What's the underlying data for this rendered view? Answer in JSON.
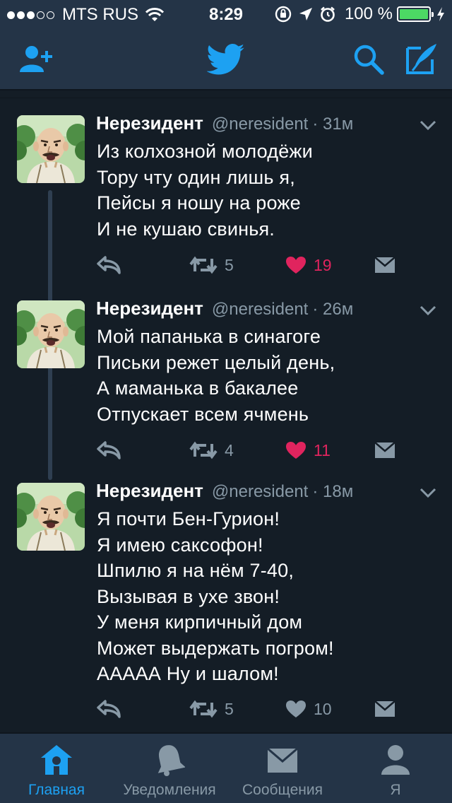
{
  "status_bar": {
    "carrier": "MTS RUS",
    "time": "8:29",
    "battery_percent": "100 %",
    "signal_bars_filled": 3,
    "signal_bars_total": 5,
    "icons": [
      "wifi-icon",
      "orientation-lock-icon",
      "location-icon",
      "alarm-icon",
      "battery-icon",
      "charging-icon"
    ]
  },
  "nav_bar": {
    "icons": [
      "add-user-icon",
      "twitter-bird-icon",
      "search-icon",
      "compose-icon"
    ]
  },
  "tweets": [
    {
      "name": "Нерезидент",
      "handle": "@neresident",
      "time": "· 31м",
      "lines": [
        "Из колхозной молодёжи",
        "Тору чту один лишь я,",
        "Пейсы я ношу на роже",
        "И не кушаю свинья."
      ],
      "retweets": "5",
      "likes": "19",
      "liked": true
    },
    {
      "name": "Нерезидент",
      "handle": "@neresident",
      "time": "· 26м",
      "lines": [
        "Мой папанька в синагоге",
        "Письки режет целый день,",
        "А маманька в бакалее",
        "Отпускает всем ячмень"
      ],
      "retweets": "4",
      "likes": "11",
      "liked": true
    },
    {
      "name": "Нерезидент",
      "handle": "@neresident",
      "time": "· 18м",
      "lines": [
        "Я почти Бен-Гурион!",
        "Я имею саксофон!",
        "Шпилю я на нём 7-40,",
        "Вызывая в ухе звон!",
        "У меня кирпичный дом",
        "Может выдержать погром!",
        "ААААА Ну и шалом!"
      ],
      "retweets": "5",
      "likes": "10",
      "liked": false
    }
  ],
  "tab_bar": {
    "tabs": [
      {
        "label": "Главная",
        "icon": "home-icon",
        "active": true
      },
      {
        "label": "Уведомления",
        "icon": "bell-icon",
        "active": false
      },
      {
        "label": "Сообщения",
        "icon": "envelope-icon",
        "active": false
      },
      {
        "label": "Я",
        "icon": "profile-icon",
        "active": false
      }
    ]
  },
  "colors": {
    "background": "#141d26",
    "bar_background": "#243447",
    "accent_blue": "#1da1f2",
    "like_red": "#e0245e",
    "secondary_text": "#8899a6",
    "battery_green": "#4cd964"
  }
}
